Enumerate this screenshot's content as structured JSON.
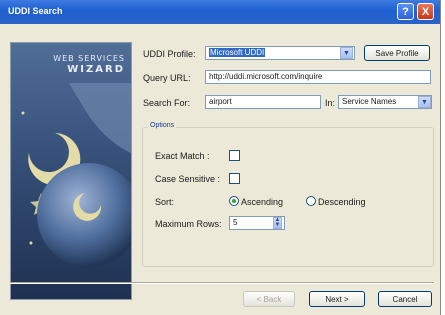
{
  "window": {
    "title": "UDDI Search"
  },
  "titlebar": {
    "help_glyph": "?",
    "close_glyph": "X"
  },
  "banner": {
    "line1": "WEB SERVICES",
    "line2": "WIZARD"
  },
  "form": {
    "profile_label": "UDDI Profile:",
    "profile_value": "Microsoft UDDI",
    "save_profile_label": "Save Profile",
    "query_url_label": "Query URL:",
    "query_url_value": "http://uddi.microsoft.com/inquire",
    "search_for_label": "Search For:",
    "search_for_value": "airport",
    "in_label": "In:",
    "in_value": "Service Names"
  },
  "options": {
    "group_title": "Options",
    "exact_match_label": "Exact Match :",
    "exact_match_checked": false,
    "case_sensitive_label": "Case Sensitive :",
    "case_sensitive_checked": false,
    "sort_label": "Sort:",
    "ascending_label": "Ascending",
    "descending_label": "Descending",
    "sort_selected": "ascending",
    "max_rows_label": "Maximum Rows:",
    "max_rows_value": "5"
  },
  "footer": {
    "back_label": "< Back",
    "next_label": "Next >",
    "cancel_label": "Cancel"
  },
  "icons": {
    "combo": "chevron-down-icon",
    "spin": "spinner-icon",
    "help": "help-icon",
    "close": "close-icon"
  },
  "colors": {
    "titlebar": "#2a63c8",
    "selection": "#316ac5",
    "dialog_bg": "#ece9d8",
    "banner": "#3b5680"
  }
}
